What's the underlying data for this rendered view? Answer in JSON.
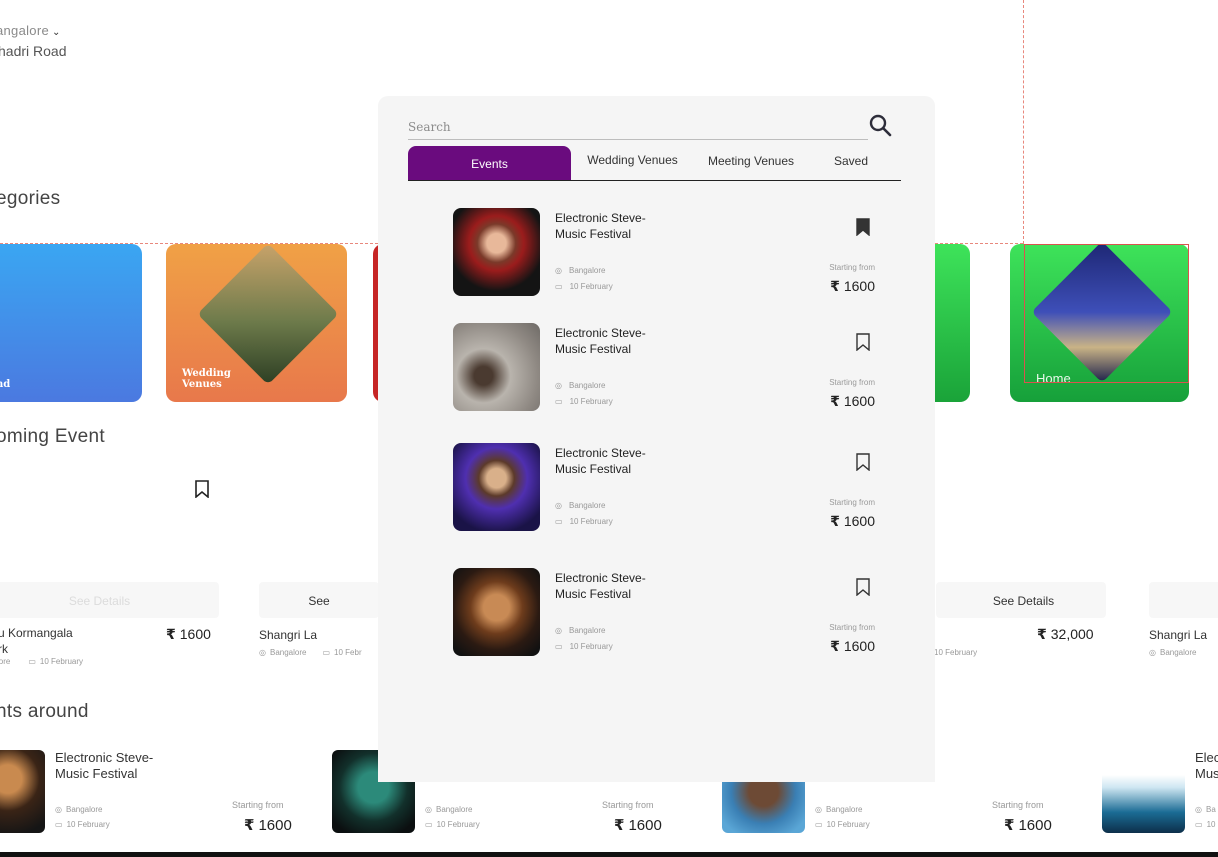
{
  "location": {
    "city": "angalore",
    "area": "hadri Road"
  },
  "sections": {
    "categories": "egories",
    "upcoming": "oming Event",
    "around": "nts around"
  },
  "categories": [
    {
      "label": "nd",
      "color": "#3aa6f2"
    },
    {
      "label": "Wedding Venues",
      "color": "#f0a146"
    },
    {
      "label": "",
      "color": "#c62525"
    },
    {
      "label": "",
      "color": "#3ee35a"
    },
    {
      "label": "Home",
      "color": "#3ee35a"
    }
  ],
  "upcoming": {
    "see_details": "See Details",
    "see_partial": "See",
    "cards": [
      {
        "name": "u Kormangala",
        "name2": "rk",
        "location": "lore",
        "date": "10 February",
        "price": "1600"
      },
      {
        "name": "Shangri La",
        "location": "Bangalore",
        "date": "10 Febr",
        "price": ""
      },
      {
        "name": "",
        "location": "",
        "date": "10 February",
        "price": "32,000"
      },
      {
        "name": "Shangri La",
        "location": "Bangalore",
        "date": "",
        "price": ""
      }
    ]
  },
  "around": {
    "starting_from": "Starting from",
    "cards": [
      {
        "name": "Electronic Steve-Music Festival",
        "location": "Bangalore",
        "date": "10 February",
        "price": "1600"
      },
      {
        "name": "",
        "location": "Bangalore",
        "date": "10 February",
        "price": "1600"
      },
      {
        "name": "",
        "location": "Bangalore",
        "date": "10 February",
        "price": "1600"
      },
      {
        "name": "Elec Mus",
        "location": "Ba",
        "date": "10",
        "price": ""
      }
    ]
  },
  "search": {
    "placeholder": "Search",
    "icon": "search-icon",
    "tabs": [
      {
        "label": "Events",
        "active": true
      },
      {
        "label": "Wedding Venues",
        "active": false
      },
      {
        "label": "Meeting Venues",
        "active": false
      },
      {
        "label": "Saved",
        "active": false
      }
    ],
    "accent": "#6a0b7e",
    "results": [
      {
        "title": "Electronic Steve-Music Festival",
        "location": "Bangalore",
        "date": "10 February",
        "from_label": "Starting from",
        "price": "1600",
        "saved": true
      },
      {
        "title": "Electronic Steve-Music Festival",
        "location": "Bangalore",
        "date": "10 February",
        "from_label": "Starting from",
        "price": "1600",
        "saved": false
      },
      {
        "title": "Electronic Steve-Music Festival",
        "location": "Bangalore",
        "date": "10 February",
        "from_label": "Starting from",
        "price": "1600",
        "saved": false
      },
      {
        "title": "Electronic Steve-Music Festival",
        "location": "Bangalore",
        "date": "10 February",
        "from_label": "Starting from",
        "price": "1600",
        "saved": false
      }
    ]
  },
  "currency_symbol": "₹"
}
